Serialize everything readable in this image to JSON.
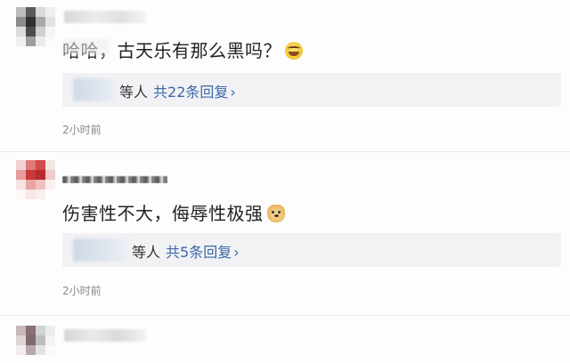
{
  "comments": [
    {
      "text": "哈哈，古天乐有那么黑吗？",
      "emoji": "laugh-emoji",
      "reply": {
        "suffix": "等人",
        "count_label": "共22条回复",
        "chevron": "›"
      },
      "time": "2小时前"
    },
    {
      "text": "伤害性不大，侮辱性极强",
      "emoji": "doge-emoji",
      "reply": {
        "suffix": "等人",
        "count_label": "共5条回复",
        "chevron": "›"
      },
      "time": "2小时前"
    }
  ],
  "colors": {
    "link": "#3b67a8",
    "text": "#222222",
    "meta": "#888888",
    "reply_bg": "#f2f2f4"
  }
}
